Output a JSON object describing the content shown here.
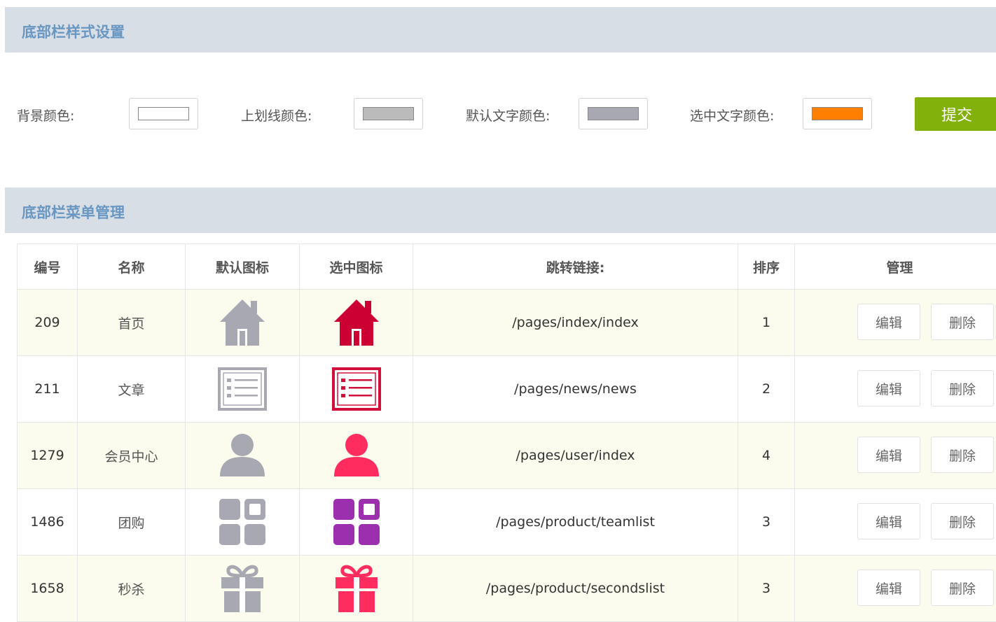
{
  "style_settings": {
    "title": "底部栏样式设置",
    "fields": [
      {
        "label": "背景颜色:",
        "color": "#ffffff"
      },
      {
        "label": "上划线颜色:",
        "color": "#bbbbbb"
      },
      {
        "label": "默认文字颜色:",
        "color": "#a8a8b2"
      },
      {
        "label": "选中文字颜色:",
        "color": "#ff7f00"
      }
    ],
    "submit_label": "提交"
  },
  "menu_management": {
    "title": "底部栏菜单管理",
    "columns": [
      "编号",
      "名称",
      "默认图标",
      "选中图标",
      "跳转链接:",
      "排序",
      "管理"
    ],
    "rows": [
      {
        "id": "209",
        "name": "首页",
        "icon": "home-icon",
        "selected_color": "#cc0033",
        "link": "/pages/index/index",
        "sort": "1"
      },
      {
        "id": "211",
        "name": "文章",
        "icon": "list-icon",
        "selected_color": "#d0103a",
        "link": "/pages/news/news",
        "sort": "2"
      },
      {
        "id": "1279",
        "name": "会员中心",
        "icon": "user-icon",
        "selected_color": "#ff2d5f",
        "link": "/pages/user/index",
        "sort": "4"
      },
      {
        "id": "1486",
        "name": "团购",
        "icon": "grid-icon",
        "selected_color": "#9b2fae",
        "link": "/pages/product/teamlist",
        "sort": "3"
      },
      {
        "id": "1658",
        "name": "秒杀",
        "icon": "gift-icon",
        "selected_color": "#ff2d5f",
        "link": "/pages/product/secondslist",
        "sort": "3"
      }
    ],
    "default_icon_color": "#a8a8b2",
    "edit_label": "编辑",
    "delete_label": "删除"
  }
}
